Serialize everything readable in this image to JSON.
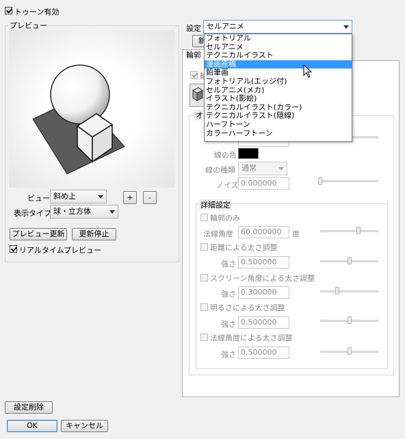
{
  "toon_enable": {
    "label": "トゥーン有効",
    "checked": true
  },
  "preview": {
    "group_title": "プレビュー",
    "view_label": "ビュー",
    "view_value": "斜め上",
    "plus_label": "+",
    "minus_label": "-",
    "display_type_label": "表示タイプ",
    "display_type_value": "球・立方体",
    "update_button": "プレビュー更新",
    "stop_button": "更新停止",
    "realtime_label": "リアルタイムプレビュー",
    "realtime_checked": true
  },
  "settings": {
    "label": "設定",
    "selected": "セルアニメ",
    "options": [
      "フォトリアル",
      "セルアニメ",
      "テクニカルイラスト",
      "漫画原稿",
      "鉛筆画",
      "フォトリアル(エッジ付)",
      "セルアニメ(メカ)",
      "イラスト(影絵)",
      "テクニカルイラスト(カラー)",
      "テクニカルイラスト(隠線)",
      "ハーフトーン",
      "カラーハーフトーン"
    ],
    "highlighted_index": 3,
    "new_button_fragment": "新",
    "tab_fragment": "輪郭",
    "group_fragment": "オ",
    "row_fragment": "輪"
  },
  "outline": {
    "line_color_label": "線の色",
    "line_color": "#000000",
    "line_type_label": "線の種類",
    "line_type_value": "通常",
    "noise_label": "ノイズ",
    "noise_value": "0.000000",
    "noise_fraction": 0.0
  },
  "advanced": {
    "group_title": "詳細設定",
    "outline_only_label": "輪郭のみ",
    "normal_angle_label": "法線角度",
    "normal_angle_value": "60.000000",
    "normal_angle_unit": "度",
    "normal_angle_fraction": 0.67,
    "distance_label": "距離による太さ調整",
    "distance_strength_label": "強さ",
    "distance_strength_value": "0.500000",
    "distance_fraction": 0.5,
    "screen_angle_label": "スクリーン角度による太さ調整",
    "screen_strength_label": "強さ",
    "screen_strength_value": "0.300000",
    "screen_fraction": 0.3,
    "brightness_label": "明るさによる太さ調整",
    "brightness_strength_label": "強さ",
    "brightness_strength_value": "0.500000",
    "brightness_fraction": 0.5,
    "normal_thick_label": "法線角度による太さ調整",
    "normal_thick_strength_label": "強さ",
    "normal_thick_strength_value": "0.500000",
    "normal_thick_fraction": 0.5
  },
  "footer": {
    "delete_button": "設定削除",
    "ok_button": "OK",
    "cancel_button": "キャンセル"
  }
}
